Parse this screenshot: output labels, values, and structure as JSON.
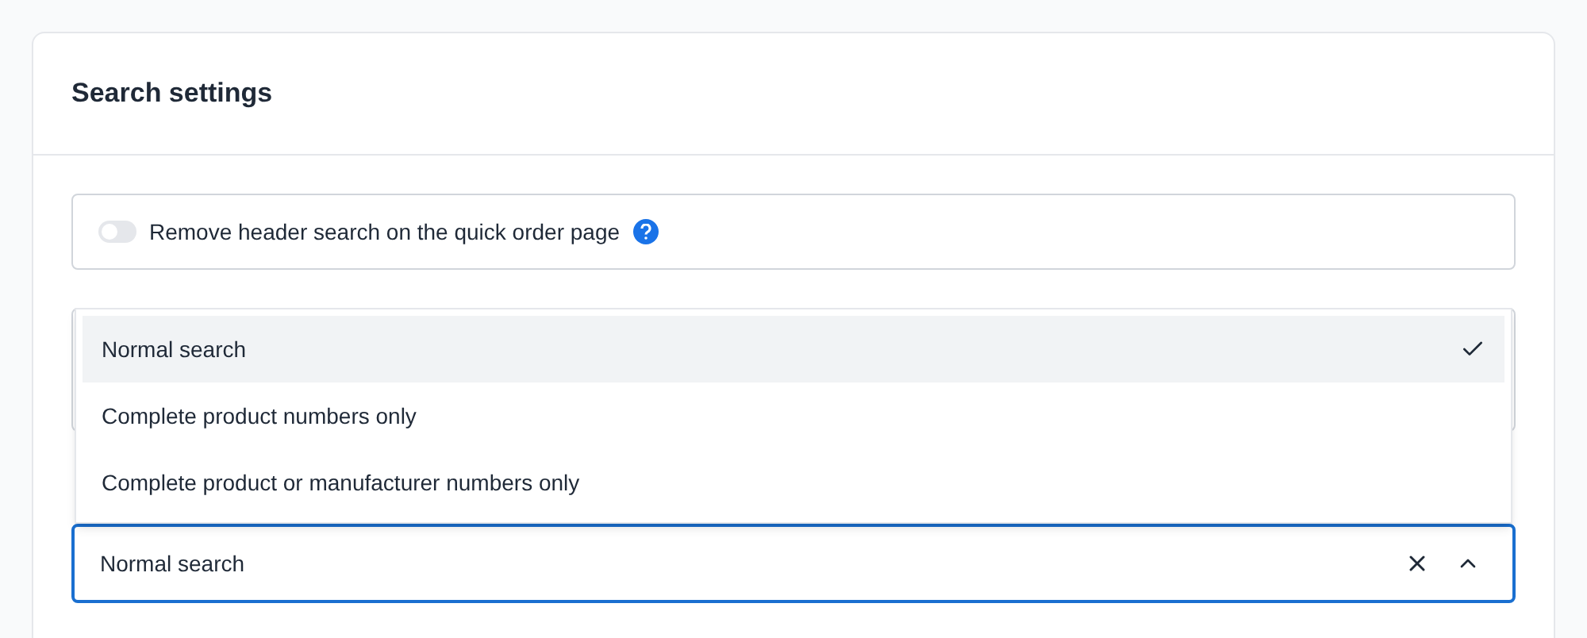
{
  "card": {
    "title": "Search settings"
  },
  "toggle": {
    "label": "Remove header search on the quick order page",
    "on": false
  },
  "select": {
    "value": "Normal search",
    "expanded": true,
    "options": [
      {
        "label": "Normal search",
        "selected": true
      },
      {
        "label": "Complete product numbers only",
        "selected": false
      },
      {
        "label": "Complete product or manufacturer numbers only",
        "selected": false
      }
    ]
  }
}
